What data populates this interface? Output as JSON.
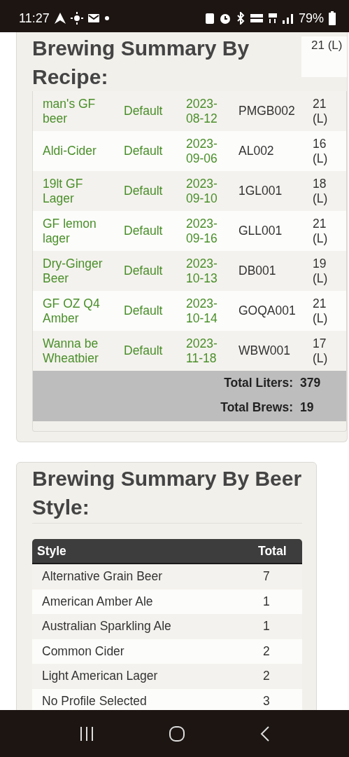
{
  "status_bar": {
    "time": "11:27",
    "battery": "79%"
  },
  "recipe_summary": {
    "title": "Brewing Summary By Recipe:",
    "partial_row": {
      "volume": "21 (L)"
    },
    "rows": [
      {
        "name": "man's GF beer",
        "brewer": "Default",
        "date": "2023-08-12",
        "code": "PMGB002",
        "volume": "21 (L)"
      },
      {
        "name": "Aldi-Cider",
        "brewer": "Default",
        "date": "2023-09-06",
        "code": "AL002",
        "volume": "16 (L)"
      },
      {
        "name": "19lt GF Lager",
        "brewer": "Default",
        "date": "2023-09-10",
        "code": "1GL001",
        "volume": "18 (L)"
      },
      {
        "name": "GF lemon lager",
        "brewer": "Default",
        "date": "2023-09-16",
        "code": "GLL001",
        "volume": "21 (L)"
      },
      {
        "name": "Dry-Ginger Beer",
        "brewer": "Default",
        "date": "2023-10-13",
        "code": "DB001",
        "volume": "19 (L)"
      },
      {
        "name": "GF OZ Q4 Amber",
        "brewer": "Default",
        "date": "2023-10-14",
        "code": "GOQA001",
        "volume": "21 (L)"
      },
      {
        "name": "Wanna be Wheatbier",
        "brewer": "Default",
        "date": "2023-11-18",
        "code": "WBW001",
        "volume": "17 (L)"
      }
    ],
    "totals": [
      {
        "label": "Total Liters:",
        "value": "379"
      },
      {
        "label": "Total Brews:",
        "value": "19"
      }
    ]
  },
  "style_summary": {
    "title": "Brewing Summary By Beer Style:",
    "columns": [
      "Style",
      "Total"
    ],
    "rows": [
      {
        "style": "Alternative Grain Beer",
        "total": "7"
      },
      {
        "style": "American Amber Ale",
        "total": "1"
      },
      {
        "style": "Australian Sparkling Ale",
        "total": "1"
      },
      {
        "style": "Common Cider",
        "total": "2"
      },
      {
        "style": "Light American Lager",
        "total": "2"
      },
      {
        "style": "No Profile Selected",
        "total": "3"
      }
    ]
  }
}
